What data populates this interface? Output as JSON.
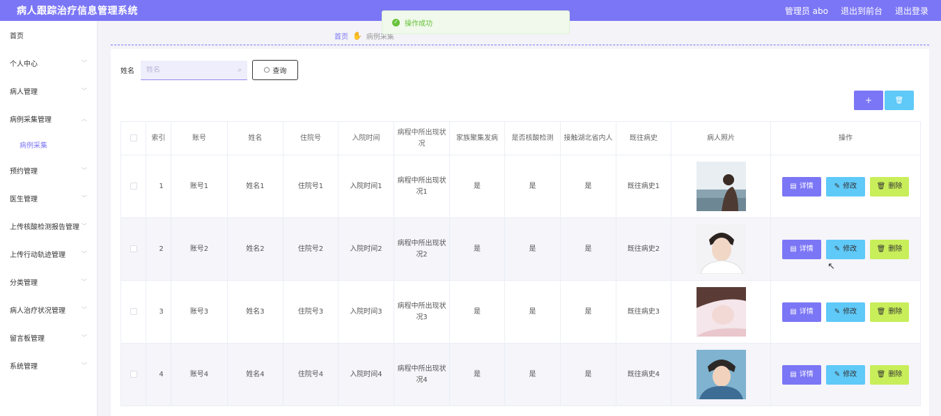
{
  "header": {
    "title": "病人跟踪治疗信息管理系统",
    "user": "管理员 abo",
    "back_front": "退出到前台",
    "logout": "退出登录"
  },
  "toast": {
    "message": "操作成功"
  },
  "sidebar": {
    "items": [
      {
        "label": "首页",
        "chevron": ""
      },
      {
        "label": "个人中心",
        "chevron": "﹀"
      },
      {
        "label": "病人管理",
        "chevron": "﹀"
      },
      {
        "label": "病例采集管理",
        "chevron": "︿"
      },
      {
        "label": "预约管理",
        "chevron": "﹀"
      },
      {
        "label": "医生管理",
        "chevron": "﹀"
      },
      {
        "label": "上传核酸检测报告管理",
        "chevron": "﹀"
      },
      {
        "label": "上传行动轨迹管理",
        "chevron": "﹀"
      },
      {
        "label": "分类管理",
        "chevron": "﹀"
      },
      {
        "label": "病人治疗状况管理",
        "chevron": "﹀"
      },
      {
        "label": "留言板管理",
        "chevron": "﹀"
      },
      {
        "label": "系统管理",
        "chevron": "﹀"
      }
    ],
    "sub_item": "病例采集"
  },
  "breadcrumb": {
    "home": "首页",
    "current": "病例采集"
  },
  "search": {
    "label": "姓名",
    "placeholder": "姓名",
    "button": "查询"
  },
  "actions": {
    "add": "+",
    "delete": "🗑"
  },
  "table": {
    "headers": [
      "索引",
      "账号",
      "姓名",
      "住院号",
      "入院时间",
      "病程中所出现状况",
      "家族聚集发病",
      "是否核酸检测",
      "接触湖北省内人",
      "既往病史",
      "病人照片",
      "操作"
    ],
    "rows": [
      {
        "idx": "1",
        "account": "账号1",
        "name": "姓名1",
        "hosp": "住院号1",
        "time": "入院时间1",
        "cond": "病程中所出现状况1",
        "family": "是",
        "test": "是",
        "contact": "是",
        "history": "既往病史1"
      },
      {
        "idx": "2",
        "account": "账号2",
        "name": "姓名2",
        "hosp": "住院号2",
        "time": "入院时间2",
        "cond": "病程中所出现状况2",
        "family": "是",
        "test": "是",
        "contact": "是",
        "history": "既往病史2"
      },
      {
        "idx": "3",
        "account": "账号3",
        "name": "姓名3",
        "hosp": "住院号3",
        "time": "入院时间3",
        "cond": "病程中所出现状况3",
        "family": "是",
        "test": "是",
        "contact": "是",
        "history": "既往病史3"
      },
      {
        "idx": "4",
        "account": "账号4",
        "name": "姓名4",
        "hosp": "住院号4",
        "time": "入院时间4",
        "cond": "病程中所出现状况4",
        "family": "是",
        "test": "是",
        "contact": "是",
        "history": "既往病史4"
      }
    ],
    "ops": {
      "detail": "详情",
      "edit": "修改",
      "delete": "删除"
    }
  },
  "colors": {
    "accent": "#7b76f5",
    "info": "#5fc9f8",
    "lime": "#c8ee5a",
    "success": "#67c23a"
  }
}
